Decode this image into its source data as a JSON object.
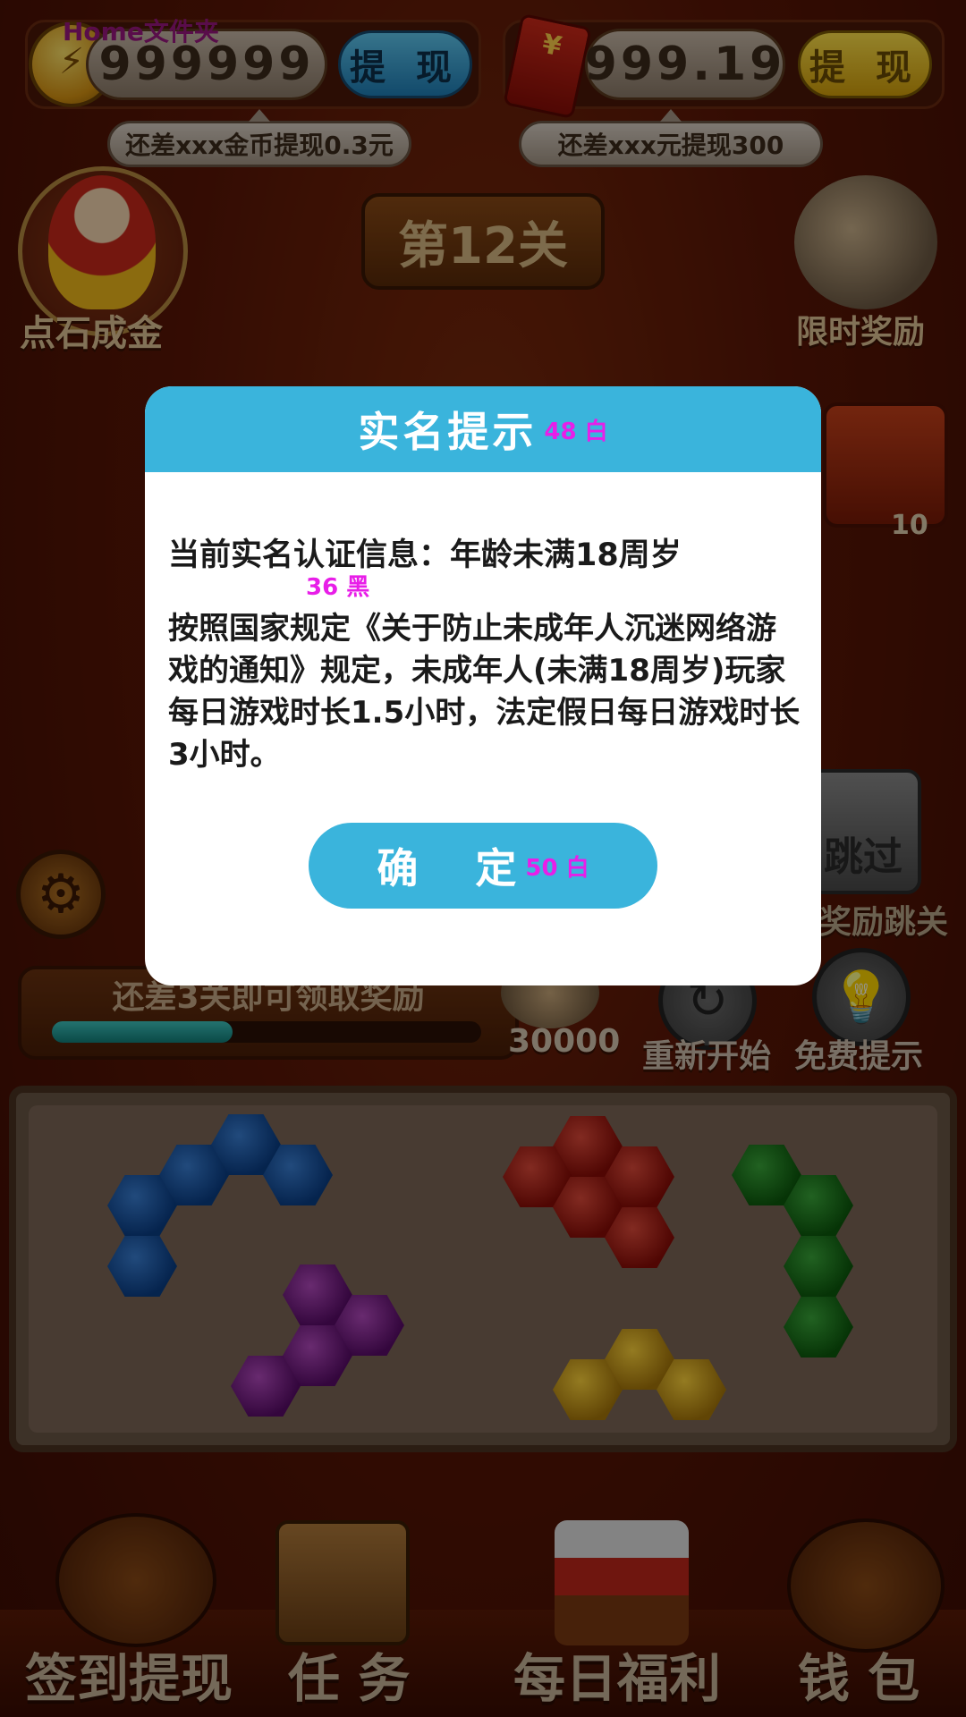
{
  "top_bar": {
    "home_label": "Home文件夹",
    "coins": {
      "value": "999999",
      "withdraw_label": "提 现",
      "tip": "还差xxx金币提现0.3元"
    },
    "cash": {
      "value": "999.19",
      "withdraw_label": "提 现",
      "tip": "还差xxx元提现300"
    }
  },
  "level": {
    "label": "第12关"
  },
  "features": {
    "left_label": "点石成金",
    "right_label": "限时奖励",
    "chest_badge": "10",
    "skip_button": "跳过",
    "skip_label": "奖励跳关"
  },
  "progress": {
    "text": "还差3关即可领取奖励",
    "fill_percent": 42,
    "reward_amount": "30000"
  },
  "actions": {
    "restart_label": "重新开始",
    "hint_label": "免费提示"
  },
  "bottom_nav": {
    "items": [
      {
        "label": "签到提现"
      },
      {
        "label": "任 务"
      },
      {
        "label": "每日福利"
      },
      {
        "label": "钱 包"
      }
    ]
  },
  "modal": {
    "title": "实名提示",
    "title_anno": "48 白",
    "line1": "当前实名认证信息：年龄未满18周岁",
    "line1_anno": "36 黑",
    "body": "按照国家规定《关于防止未成年人沉迷网络游戏的通知》规定，未成年人(未满18周岁)玩家每日游戏时长1.5小时，法定假日每日游戏时长3小时。",
    "confirm_label": "确 定",
    "confirm_anno": "50 白"
  },
  "colors": {
    "modal_accent": "#3ab4dc",
    "annotation": "#e81ee8",
    "background": "#5a1606"
  }
}
